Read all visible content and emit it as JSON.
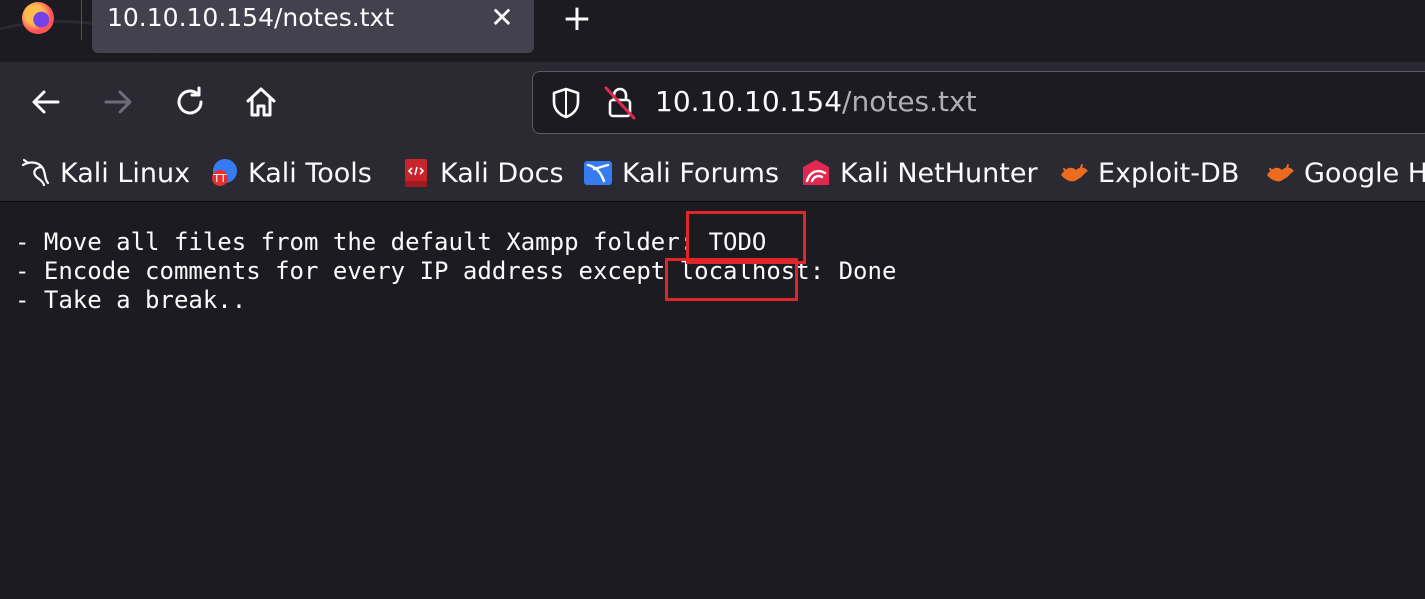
{
  "tab": {
    "title": "10.10.10.154/notes.txt",
    "close_glyph": "✕",
    "new_tab_glyph": "+"
  },
  "urlbar": {
    "host": "10.10.10.154",
    "path": "/notes.txt"
  },
  "bookmarks": [
    {
      "label": "Kali Linux",
      "icon": "kali-dragon-icon"
    },
    {
      "label": "Kali Tools",
      "icon": "kali-tools-icon"
    },
    {
      "label": "Kali Docs",
      "icon": "kali-docs-icon"
    },
    {
      "label": "Kali Forums",
      "icon": "kali-forums-icon"
    },
    {
      "label": "Kali NetHunter",
      "icon": "kali-nethunter-icon"
    },
    {
      "label": "Exploit-DB",
      "icon": "exploit-db-icon"
    },
    {
      "label": "Google H",
      "icon": "google-hacking-icon"
    }
  ],
  "notes": {
    "lines": [
      "- Move all files from the default Xampp folder: TODO",
      "- Encode comments for every IP address except localhost: Done",
      "- Take a break.."
    ]
  },
  "annotations": {
    "box_color": "#e0252a"
  },
  "colors": {
    "background": "#1c1b22",
    "toolbar": "#2b2a33",
    "tab_active": "#42414d",
    "text": "#fbfbfe"
  }
}
